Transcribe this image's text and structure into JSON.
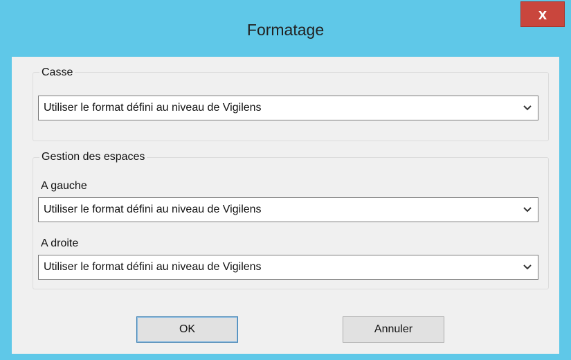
{
  "window": {
    "title": "Formatage",
    "close_glyph": "x"
  },
  "casse": {
    "legend": "Casse",
    "value": "Utiliser le format défini au niveau de Vigilens"
  },
  "espaces": {
    "legend": "Gestion des espaces",
    "gauche_label": "A gauche",
    "gauche_value": "Utiliser le format défini au niveau de Vigilens",
    "droite_label": "A droite",
    "droite_value": "Utiliser le format défini au niveau de Vigilens"
  },
  "buttons": {
    "ok": "OK",
    "cancel": "Annuler"
  },
  "colors": {
    "title_bar": "#5fc8e8",
    "close_button": "#c9463d",
    "client_bg": "#f0f0f0"
  },
  "icons": {
    "dropdown": "chevron-down-icon",
    "close": "close-icon"
  }
}
